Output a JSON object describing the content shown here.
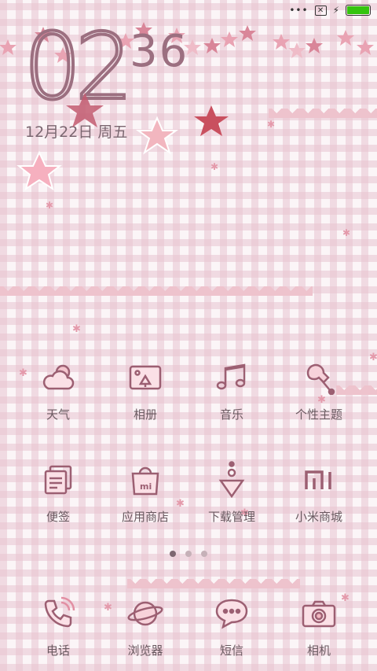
{
  "status": {
    "more": "•••",
    "close": "✕",
    "charge": "⚡"
  },
  "clock": {
    "hour": "02",
    "minute": "36",
    "date": "12月22日 周五"
  },
  "apps_row1": [
    {
      "label": "天气",
      "icon": "weather-icon"
    },
    {
      "label": "相册",
      "icon": "gallery-icon"
    },
    {
      "label": "音乐",
      "icon": "music-icon"
    },
    {
      "label": "个性主题",
      "icon": "theme-icon"
    }
  ],
  "apps_row2": [
    {
      "label": "便签",
      "icon": "notes-icon"
    },
    {
      "label": "应用商店",
      "icon": "app-store-icon"
    },
    {
      "label": "下载管理",
      "icon": "download-icon"
    },
    {
      "label": "小米商城",
      "icon": "mi-store-icon"
    }
  ],
  "dock": [
    {
      "label": "电话",
      "icon": "phone-icon"
    },
    {
      "label": "浏览器",
      "icon": "browser-icon"
    },
    {
      "label": "短信",
      "icon": "sms-icon"
    },
    {
      "label": "相机",
      "icon": "camera-icon"
    }
  ],
  "pager": {
    "pages": 3,
    "current": 1
  },
  "colors": {
    "icon_stroke": "#9c5f72",
    "battery": "#34c40e",
    "star_pink": "#f3a9b9",
    "star_red": "#c75464"
  }
}
